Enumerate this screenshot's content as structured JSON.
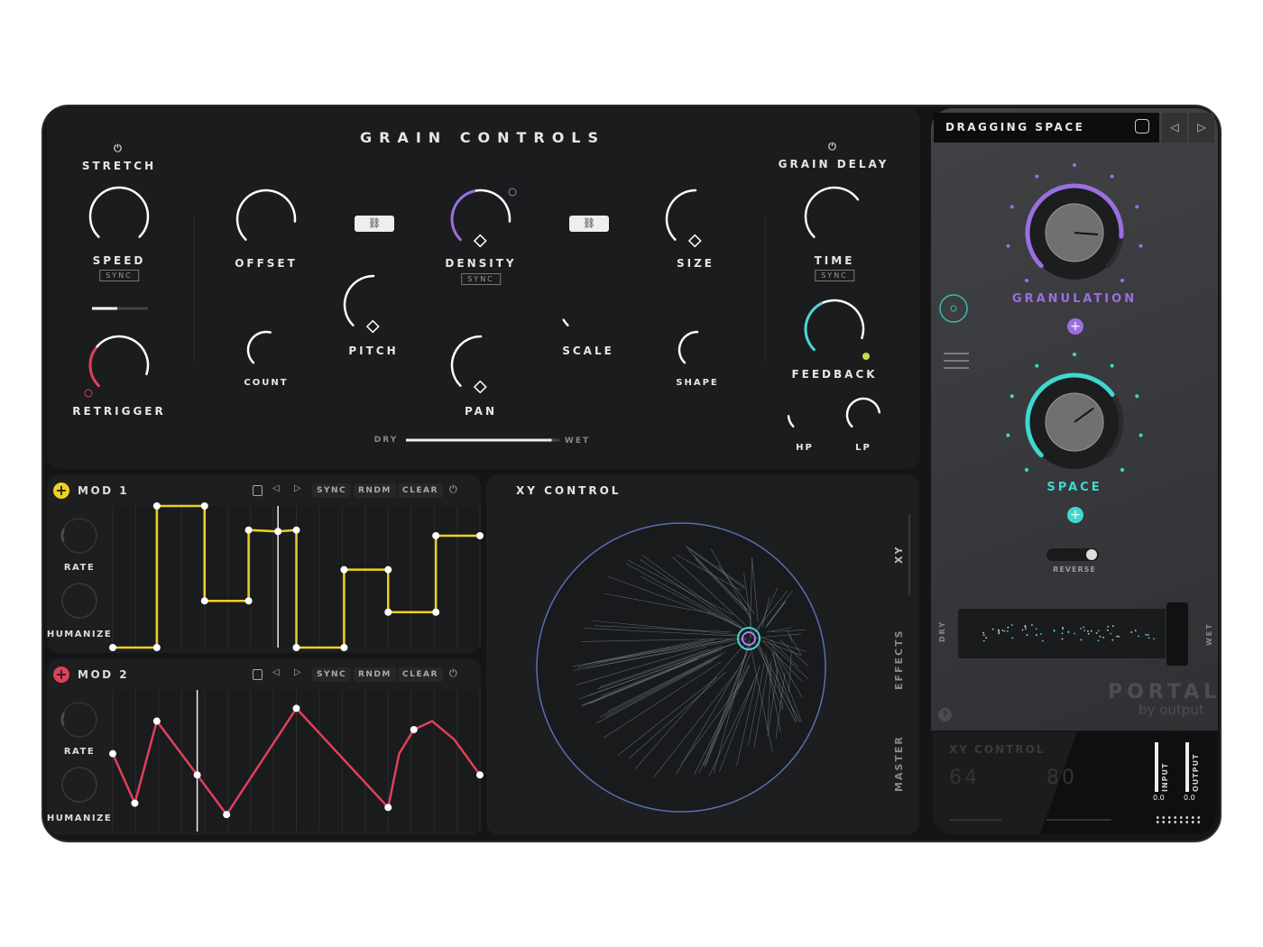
{
  "grain_controls": {
    "title": "GRAIN CONTROLS",
    "stretch": "STRETCH",
    "grain_delay": "GRAIN DELAY",
    "sync": "SYNC",
    "dry": "DRY",
    "wet": "WET",
    "mix": 0.95,
    "stretch_slider": 0.45,
    "knobs": [
      {
        "id": "speed",
        "label": "SPEED",
        "value": 1.0,
        "color": "#ffffff"
      },
      {
        "id": "retrigger",
        "label": "RETRIGGER",
        "value": 0.9,
        "mod": 0.3,
        "color": "#e0405a"
      },
      {
        "id": "offset",
        "label": "OFFSET",
        "value": 0.85,
        "color": "#ffffff"
      },
      {
        "id": "count",
        "label": "COUNT",
        "value": 0.55,
        "color": "#ffffff"
      },
      {
        "id": "pitch",
        "label": "PITCH",
        "value": 0.5,
        "color": "#ffffff"
      },
      {
        "id": "density",
        "label": "DENSITY",
        "value": 0.85,
        "mod": 0.45,
        "color": "#9b6fe0"
      },
      {
        "id": "pan",
        "label": "PAN",
        "value": 0.5,
        "color": "#ffffff"
      },
      {
        "id": "scale",
        "label": "SCALE",
        "value": 0.05,
        "color": "#ffffff"
      },
      {
        "id": "size",
        "label": "SIZE",
        "value": 0.5,
        "color": "#ffffff"
      },
      {
        "id": "shape",
        "label": "SHAPE",
        "value": 0.5,
        "color": "#ffffff"
      },
      {
        "id": "time",
        "label": "TIME",
        "value": 0.7,
        "color": "#ffffff"
      },
      {
        "id": "feedback",
        "label": "FEEDBACK",
        "value": 0.9,
        "mod": 0.4,
        "color": "#4fd6d0"
      },
      {
        "id": "hp",
        "label": "HP",
        "value": 0.15,
        "color": "#ffffff"
      },
      {
        "id": "lp",
        "label": "LP",
        "value": 0.8,
        "color": "#ffffff"
      }
    ]
  },
  "mod1": {
    "title": "MOD 1",
    "color": "#f0d020",
    "rate": "RATE",
    "humanize": "HUMANIZE",
    "buttons": [
      "SYNC",
      "RNDM",
      "CLEAR"
    ],
    "points": [
      [
        0,
        0
      ],
      [
        0.12,
        0
      ],
      [
        0.12,
        1
      ],
      [
        0.25,
        1
      ],
      [
        0.25,
        0.33
      ],
      [
        0.37,
        0.33
      ],
      [
        0.37,
        0.83
      ],
      [
        0.45,
        0.82
      ],
      [
        0.5,
        0.83
      ],
      [
        0.5,
        0
      ],
      [
        0.63,
        0
      ],
      [
        0.63,
        0.55
      ],
      [
        0.75,
        0.55
      ],
      [
        0.75,
        0.25
      ],
      [
        0.88,
        0.25
      ],
      [
        0.88,
        0.79
      ],
      [
        1,
        0.79
      ]
    ],
    "playhead": 0.45
  },
  "mod2": {
    "title": "MOD 2",
    "color": "#e0405a",
    "rate": "RATE",
    "humanize": "HUMANIZE",
    "buttons": [
      "SYNC",
      "RNDM",
      "CLEAR"
    ],
    "points": [
      [
        0,
        0.55
      ],
      [
        0.06,
        0.2
      ],
      [
        0.12,
        0.78
      ],
      [
        0.23,
        0.4
      ],
      [
        0.31,
        0.12
      ],
      [
        0.5,
        0.87
      ],
      [
        0.75,
        0.17
      ],
      [
        0.78,
        0.55
      ],
      [
        0.82,
        0.72
      ],
      [
        0.87,
        0.78
      ],
      [
        0.93,
        0.65
      ],
      [
        1,
        0.4
      ]
    ],
    "playhead": 0.23
  },
  "xy": {
    "title": "XY CONTROL",
    "tabs": [
      "XY",
      "EFFECTS",
      "MASTER"
    ]
  },
  "right": {
    "preset": "DRAGGING SPACE",
    "granulation": "GRANULATION",
    "granulation_value": 0.85,
    "granulation_color": "#9b6fe0",
    "space": "SPACE",
    "space_value": 0.7,
    "space_color": "#3fd8d0",
    "reverse": "REVERSE",
    "dry": "DRY",
    "wet": "WET",
    "brand": "PORTAL",
    "brand_sub": "by output",
    "help": "?",
    "bottom": {
      "title": "XY CONTROL",
      "x": "64",
      "y": "80",
      "input": "INPUT",
      "output": "OUTPUT",
      "input_val": "0.0",
      "output_val": "0.0"
    }
  }
}
